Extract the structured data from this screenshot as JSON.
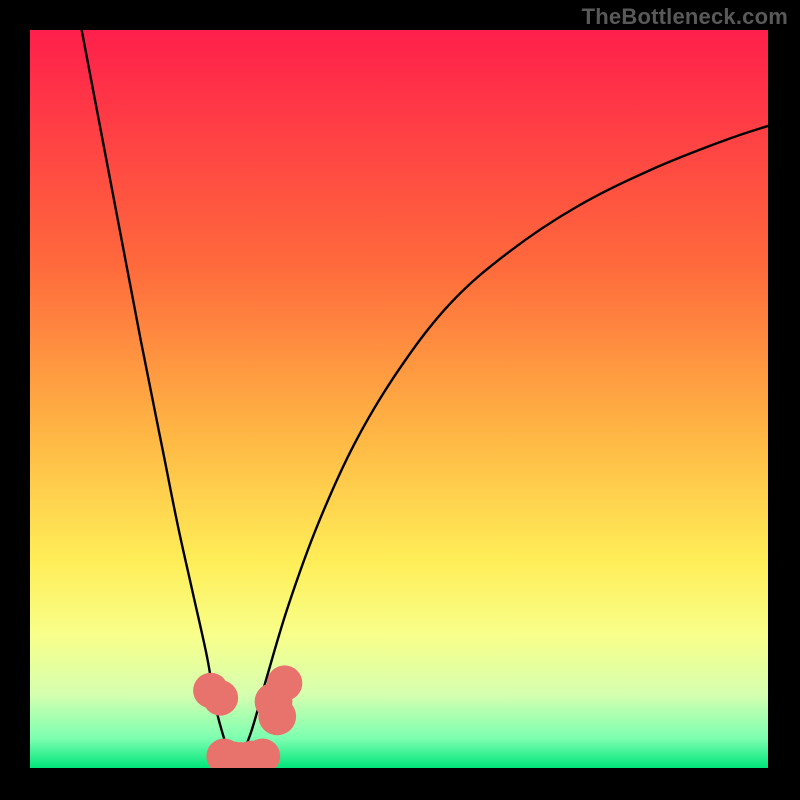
{
  "watermark": "TheBottleneck.com",
  "chart_data": {
    "type": "line",
    "title": "",
    "xlabel": "",
    "ylabel": "",
    "xlim": [
      0,
      100
    ],
    "ylim": [
      0,
      100
    ],
    "gradient_stops": [
      {
        "offset": 0,
        "color": "#ff1f4b"
      },
      {
        "offset": 0.32,
        "color": "#ff6a3c"
      },
      {
        "offset": 0.55,
        "color": "#ffb744"
      },
      {
        "offset": 0.72,
        "color": "#ffee58"
      },
      {
        "offset": 0.82,
        "color": "#f8ff8a"
      },
      {
        "offset": 0.9,
        "color": "#d6ffb0"
      },
      {
        "offset": 0.96,
        "color": "#7dffb0"
      },
      {
        "offset": 1.0,
        "color": "#00e57a"
      }
    ],
    "series": [
      {
        "name": "left-curve",
        "x": [
          7,
          11,
          15,
          18,
          20,
          22,
          24,
          25,
          26,
          27,
          28
        ],
        "y": [
          100,
          79,
          58,
          43,
          33,
          24,
          15,
          9,
          5,
          2,
          0
        ]
      },
      {
        "name": "right-curve",
        "x": [
          28,
          30,
          32,
          35,
          39,
          44,
          50,
          57,
          65,
          74,
          84,
          94,
          100
        ],
        "y": [
          0,
          5,
          12,
          22,
          33,
          44,
          54,
          63,
          70,
          76,
          81,
          85,
          87
        ]
      }
    ],
    "markers": [
      {
        "x": 24.5,
        "y": 10.5,
        "r": 1.5
      },
      {
        "x": 25.8,
        "y": 9.5,
        "r": 1.5
      },
      {
        "x": 26.3,
        "y": 1.6,
        "r": 1.5
      },
      {
        "x": 27.5,
        "y": 1.2,
        "r": 1.5
      },
      {
        "x": 28.5,
        "y": 1.1,
        "r": 1.5
      },
      {
        "x": 30.0,
        "y": 1.3,
        "r": 1.5
      },
      {
        "x": 31.5,
        "y": 1.6,
        "r": 1.5
      },
      {
        "x": 33.0,
        "y": 9.0,
        "r": 1.6
      },
      {
        "x": 33.5,
        "y": 7.0,
        "r": 1.6
      },
      {
        "x": 34.5,
        "y": 11.5,
        "r": 1.5
      }
    ],
    "marker_color": "#e8736d"
  }
}
